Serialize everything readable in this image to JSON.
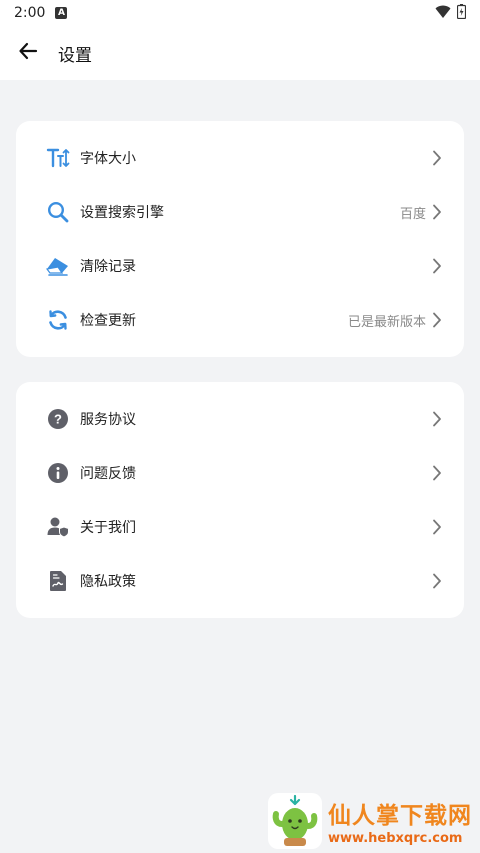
{
  "status_bar": {
    "time": "2:00",
    "notif_icon": "A"
  },
  "header": {
    "title": "设置"
  },
  "group1": [
    {
      "label": "字体大小",
      "value": "",
      "icon": "font-size-icon"
    },
    {
      "label": "设置搜索引擎",
      "value": "百度",
      "icon": "search-icon"
    },
    {
      "label": "清除记录",
      "value": "",
      "icon": "eraser-icon"
    },
    {
      "label": "检查更新",
      "value": "已是最新版本",
      "icon": "refresh-icon"
    }
  ],
  "group2": [
    {
      "label": "服务协议",
      "icon": "question-icon"
    },
    {
      "label": "问题反馈",
      "icon": "info-icon"
    },
    {
      "label": "关于我们",
      "icon": "user-shield-icon"
    },
    {
      "label": "隐私政策",
      "icon": "document-icon"
    }
  ],
  "watermark": {
    "title": "仙人掌下载网",
    "url": "www.hebxqrc.com"
  },
  "colors": {
    "accent_blue": "#3b8fe0",
    "icon_gray": "#5f6068",
    "background": "#f2f3f5"
  }
}
